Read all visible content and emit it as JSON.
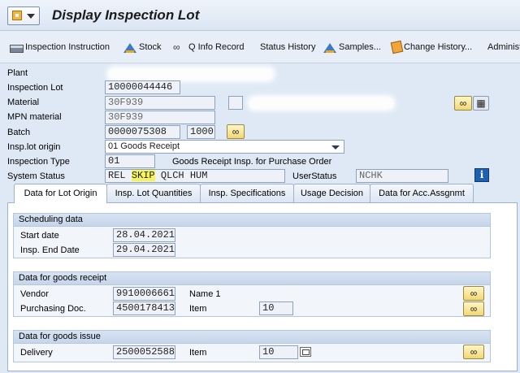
{
  "window": {
    "title": "Display Inspection Lot"
  },
  "toolbar": {
    "items": [
      {
        "label": "Inspection Instruction",
        "icon": "printer-icon"
      },
      {
        "label": "Stock",
        "icon": "mountain-icon"
      },
      {
        "label": "Q Info Record",
        "icon": "glasses-icon"
      },
      {
        "label": "Status History",
        "icon": ""
      },
      {
        "label": "Samples...",
        "icon": "mountain-icon"
      },
      {
        "label": "Change History...",
        "icon": "stamp-icon"
      },
      {
        "label": "Administ",
        "icon": ""
      }
    ]
  },
  "header": {
    "plant_label": "Plant",
    "inspection_lot_label": "Inspection Lot",
    "inspection_lot": "10000044446",
    "material_label": "Material",
    "material": "30F939",
    "mpn_label": "MPN material",
    "mpn": "30F939",
    "batch_label": "Batch",
    "batch": "0000075308",
    "batch_qty": "1000",
    "origin_label": "Insp.lot origin",
    "origin": "01 Goods Receipt",
    "type_label": "Inspection Type",
    "type": "01",
    "type_desc": "Goods Receipt Insp. for Purchase Order",
    "system_status_label": "System Status",
    "status_rel": "REL",
    "status_skip": "SKIP",
    "status_rest": "QLCH HUM",
    "user_status_label": "UserStatus",
    "user_status": "NCHK"
  },
  "tabs": [
    {
      "label": "Data for Lot Origin",
      "active": true
    },
    {
      "label": "Insp. Lot Quantities"
    },
    {
      "label": "Insp. Specifications"
    },
    {
      "label": "Usage Decision"
    },
    {
      "label": "Data for Acc.Assgnmt"
    }
  ],
  "scheduling": {
    "title": "Scheduling data",
    "start_label": "Start date",
    "start": "28.04.2021",
    "end_label": "Insp. End Date",
    "end": "29.04.2021"
  },
  "goods_receipt": {
    "title": "Data for goods receipt",
    "vendor_label": "Vendor",
    "vendor": "9910006661",
    "vendor_name": "Name 1",
    "po_label": "Purchasing Doc.",
    "po": "4500178413",
    "item_label": "Item",
    "item": "10"
  },
  "goods_issue": {
    "title": "Data for goods issue",
    "delivery_label": "Delivery",
    "delivery": "2500052588",
    "item_label": "Item",
    "item": "10"
  },
  "colors": {
    "highlight": "#f7f45a",
    "info_blue": "#1f5fb0"
  }
}
